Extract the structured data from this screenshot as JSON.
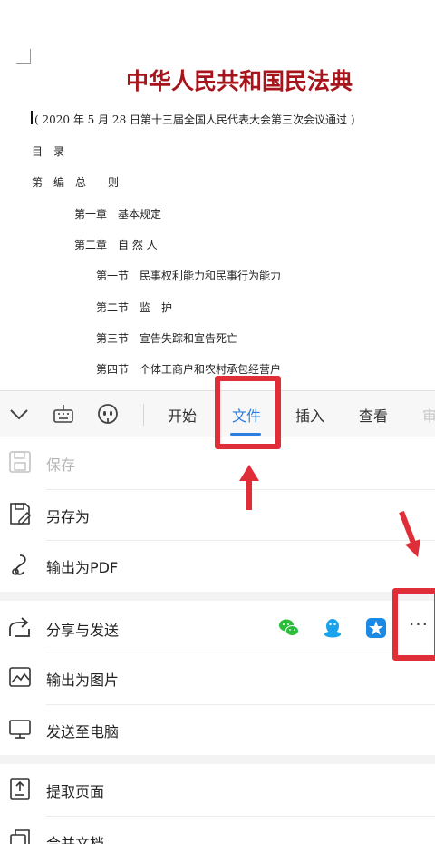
{
  "document": {
    "title": "中华人民共和国民法典",
    "subtitle": "( 2020 年 5 月 28 日第十三届全国人民代表大会第三次会议通过 )",
    "toc_heading": "目　录",
    "lines": [
      "第一编　总　　则",
      "第一章　基本规定",
      "第二章　自 然 人",
      "第一节　民事权利能力和民事行为能力",
      "第二节　监　护",
      "第三节　宣告失踪和宣告死亡",
      "第四节　个体工商户和农村承包经营户"
    ]
  },
  "toolbar": {
    "icons": [
      "chevron-down-icon",
      "keyboard-icon",
      "voice-assistant-icon"
    ],
    "tabs": [
      {
        "label": "开始",
        "active": false
      },
      {
        "label": "文件",
        "active": true
      },
      {
        "label": "插入",
        "active": false
      },
      {
        "label": "查看",
        "active": false
      },
      {
        "label": "审",
        "active": false
      }
    ]
  },
  "menu": {
    "items": [
      {
        "label": "保存",
        "icon": "save-icon",
        "enabled": false
      },
      {
        "label": "另存为",
        "icon": "save-as-icon",
        "enabled": true
      },
      {
        "label": "输出为PDF",
        "icon": "pdf-icon",
        "enabled": true
      },
      {
        "label": "分享与发送",
        "icon": "share-icon",
        "enabled": true
      },
      {
        "label": "输出为图片",
        "icon": "image-export-icon",
        "enabled": true
      },
      {
        "label": "发送至电脑",
        "icon": "monitor-icon",
        "enabled": true
      },
      {
        "label": "提取页面",
        "icon": "extract-page-icon",
        "enabled": true
      },
      {
        "label": "合并文档",
        "icon": "merge-doc-icon",
        "enabled": true
      }
    ],
    "share_apps": [
      "wechat-icon",
      "qq-icon",
      "dingtalk-icon"
    ],
    "more_label": "···"
  },
  "colors": {
    "title_red": "#a8141b",
    "accent_blue": "#2a7de1",
    "annotation_red": "#e02e39",
    "wechat_green": "#2bbd3a",
    "qq_blue": "#1aa3ea"
  }
}
